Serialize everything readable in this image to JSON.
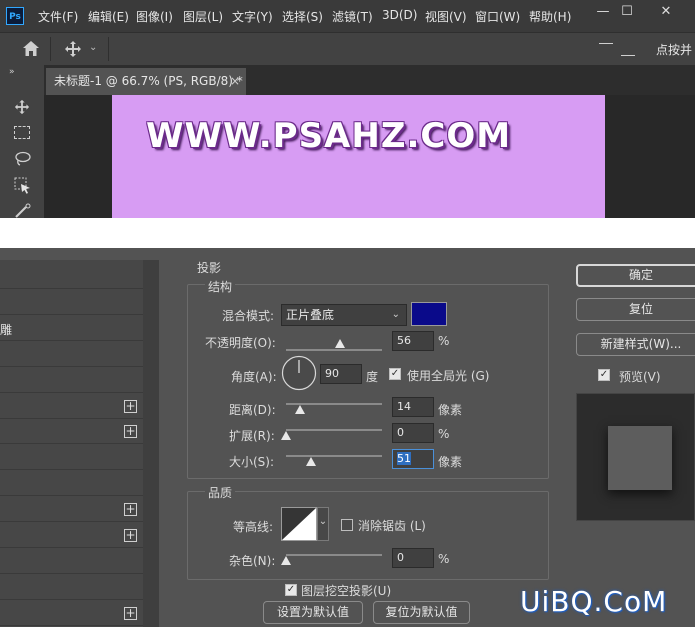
{
  "menubar": {
    "logo": "Ps",
    "items": [
      "文件(F)",
      "编辑(E)",
      "图像(I)",
      "图层(L)",
      "文字(Y)",
      "选择(S)",
      "滤镜(T)",
      "3D(D)",
      "视图(V)",
      "窗口(W)",
      "帮助(H)"
    ],
    "window_controls": [
      "—",
      "☐",
      "✕"
    ]
  },
  "optionsbar": {
    "partial_right_text": "点按并"
  },
  "document": {
    "tab_title": "未标题-1 @ 66.7% (PS, RGB/8) *",
    "tab_close": "×",
    "canvas_text": "WWW.PSAHZ.COM",
    "canvas_color": "#d79cf3"
  },
  "style_list": {
    "rows": [
      {
        "label": "",
        "plus": false
      },
      {
        "label": "",
        "plus": false
      },
      {
        "label": "雕",
        "plus": false
      },
      {
        "label": "",
        "plus": false
      },
      {
        "label": "",
        "plus": false
      },
      {
        "label": "",
        "plus": true
      },
      {
        "label": "",
        "plus": true
      },
      {
        "label": "",
        "plus": false
      },
      {
        "label": "",
        "plus": false
      },
      {
        "label": "",
        "plus": true
      },
      {
        "label": "",
        "plus": true
      },
      {
        "label": "",
        "plus": false
      },
      {
        "label": "",
        "plus": false
      },
      {
        "label": "",
        "plus": true
      }
    ]
  },
  "drop_shadow": {
    "section_title": "投影",
    "structure": {
      "title": "结构",
      "blend_mode_label": "混合模式:",
      "blend_mode_value": "正片叠底",
      "shadow_color": "#0a0a8a",
      "opacity_label": "不透明度(O):",
      "opacity_value": "56",
      "opacity_unit": "%",
      "opacity_fraction": 0.56,
      "angle_label": "角度(A):",
      "angle_value": "90",
      "angle_unit": "度",
      "global_light_label": "使用全局光 (G)",
      "global_light_checked": true,
      "distance_label": "距离(D):",
      "distance_value": "14",
      "distance_unit": "像素",
      "spread_label": "扩展(R):",
      "spread_value": "0",
      "spread_unit": "%",
      "size_label": "大小(S):",
      "size_value": "51",
      "size_unit": "像素"
    },
    "quality": {
      "title": "品质",
      "contour_label": "等高线:",
      "antialias_label": "消除锯齿 (L)",
      "antialias_checked": false,
      "noise_label": "杂色(N):",
      "noise_value": "0",
      "noise_unit": "%"
    },
    "knockout_label": "图层挖空投影(U)",
    "knockout_checked": true,
    "set_default_label": "设置为默认值",
    "reset_default_label": "复位为默认值"
  },
  "buttons": {
    "ok": "确定",
    "reset": "复位",
    "new_style": "新建样式(W)...",
    "preview_label": "预览(V)",
    "preview_checked": true
  },
  "watermark": "UiBQ.CoM"
}
